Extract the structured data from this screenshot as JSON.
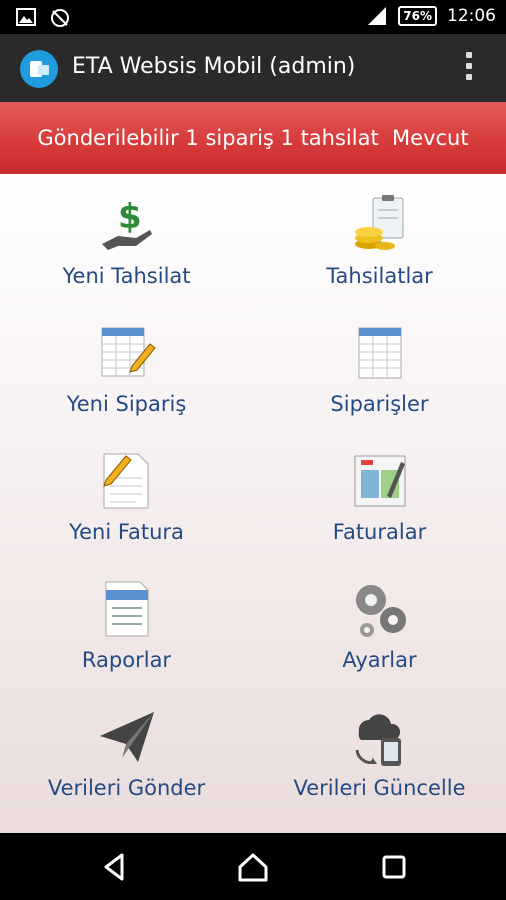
{
  "status_bar": {
    "battery": "76%",
    "time": "12:06"
  },
  "app_bar": {
    "title": "ETA Websis Mobil (admin)"
  },
  "banner": {
    "text": "Gönderilebilir 1 sipariş 1 tahsilat  Mevcut"
  },
  "menu": [
    {
      "label": "Yeni Tahsilat",
      "icon": "money-hand-icon"
    },
    {
      "label": "Tahsilatlar",
      "icon": "coins-clipboard-icon"
    },
    {
      "label": "Yeni Sipariş",
      "icon": "spreadsheet-pencil-icon"
    },
    {
      "label": "Siparişler",
      "icon": "spreadsheet-icon"
    },
    {
      "label": "Yeni Fatura",
      "icon": "invoice-pencil-icon"
    },
    {
      "label": "Faturalar",
      "icon": "invoice-icon"
    },
    {
      "label": "Raporlar",
      "icon": "report-icon"
    },
    {
      "label": "Ayarlar",
      "icon": "gears-icon"
    },
    {
      "label": "Verileri Gönder",
      "icon": "paper-plane-icon"
    },
    {
      "label": "Verileri Güncelle",
      "icon": "cloud-sync-icon"
    }
  ]
}
